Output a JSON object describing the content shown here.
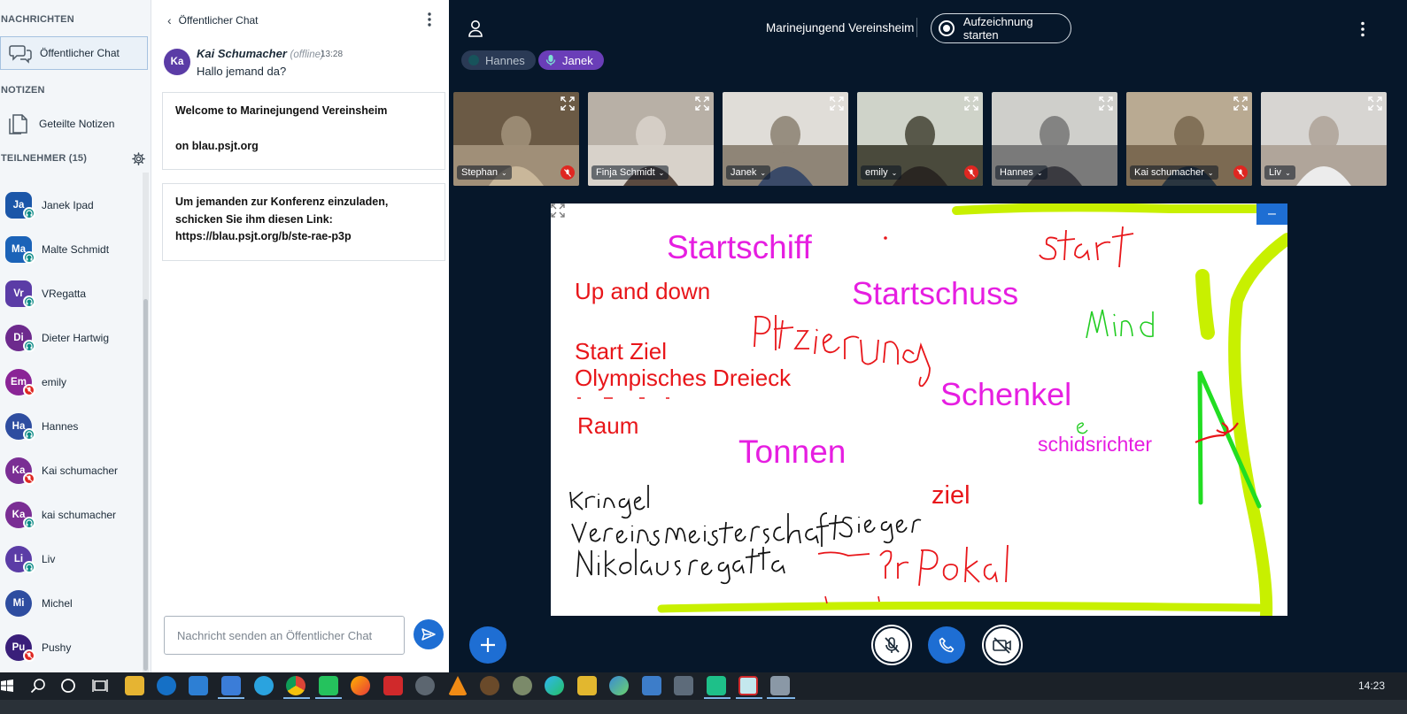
{
  "sidebar": {
    "messages_title": "NACHRICHTEN",
    "public_chat_label": "Öffentlicher Chat",
    "notes_title": "NOTIZEN",
    "shared_notes_label": "Geteilte Notizen",
    "participants_title": "TEILNEHMER (15)",
    "users": [
      {
        "initials": "Ja",
        "name": "Janek Ipad",
        "color": "#1b56a8",
        "status": "listen"
      },
      {
        "initials": "Ma",
        "name": "Malte Schmidt",
        "color": "#1b63b8",
        "status": "listen"
      },
      {
        "initials": "Vr",
        "name": "VRegatta",
        "color": "#5b3ca6",
        "status": "listen"
      },
      {
        "initials": "Di",
        "name": "Dieter Hartwig",
        "color": "#6d2a8d",
        "status": "listen"
      },
      {
        "initials": "Em",
        "name": "emily",
        "color": "#8a2496",
        "status": "muted"
      },
      {
        "initials": "Ha",
        "name": "Hannes",
        "color": "#2e4da0",
        "status": "listen"
      },
      {
        "initials": "Ka",
        "name": "Kai schumacher",
        "color": "#7a2e94",
        "status": "muted"
      },
      {
        "initials": "Ka",
        "name": "kai schumacher",
        "color": "#7a2e94",
        "status": "listen"
      },
      {
        "initials": "Li",
        "name": "Liv",
        "color": "#5b3ca6",
        "status": "listen"
      },
      {
        "initials": "Mi",
        "name": "Michel",
        "color": "#2e4da0",
        "status": "none"
      },
      {
        "initials": "Pu",
        "name": "Pushy",
        "color": "#3a1f7a",
        "status": "muted"
      }
    ]
  },
  "chat": {
    "title": "Öffentlicher Chat",
    "message": {
      "initials": "Ka",
      "author": "Kai Schumacher",
      "status": "(offline)",
      "time": "13:28",
      "text": "Hallo jemand da?"
    },
    "welcome_line1": "Welcome to Marinejungend Vereinsheim",
    "welcome_line2": "on blau.psjt.org",
    "invite_line1": "Um jemanden zur Konferenz einzuladen,",
    "invite_line2": "schicken Sie ihm diesen Link:",
    "invite_link": "https://blau.psjt.org/b/ste-rae-p3p",
    "input_placeholder": "Nachricht senden an Öffentlicher Chat"
  },
  "header": {
    "meeting_title": "Marinejungend Vereinsheim",
    "record_label": "Aufzeichnung starten"
  },
  "talkers": [
    {
      "name": "Hannes",
      "state": "inactive"
    },
    {
      "name": "Janek",
      "state": "active"
    }
  ],
  "videos": [
    {
      "name": "Stephan",
      "muted": true
    },
    {
      "name": "Finja Schmidt",
      "muted": false
    },
    {
      "name": "Janek",
      "muted": false
    },
    {
      "name": "emily",
      "muted": true
    },
    {
      "name": "Hannes",
      "muted": false
    },
    {
      "name": "Kai schumacher",
      "muted": true
    },
    {
      "name": "Liv",
      "muted": false
    }
  ],
  "whiteboard": {
    "startschiff": "Startschiff",
    "startschuss": "Startschuss",
    "up_and_down": "Up and down",
    "start_ziel": "Start Ziel",
    "olympisches": "Olympisches Dreieck",
    "schenkel": "Schenkel",
    "raum": "Raum",
    "tonnen": "Tonnen",
    "schidsrichter": "schidsrichter",
    "ziel": "ziel"
  },
  "taskbar": {
    "clock": "14:23"
  },
  "colors": {
    "accent": "#1e6ed3",
    "magenta": "#e61ee1",
    "red": "#e8161a",
    "lime": "#c8f000",
    "green": "#22dd22"
  }
}
